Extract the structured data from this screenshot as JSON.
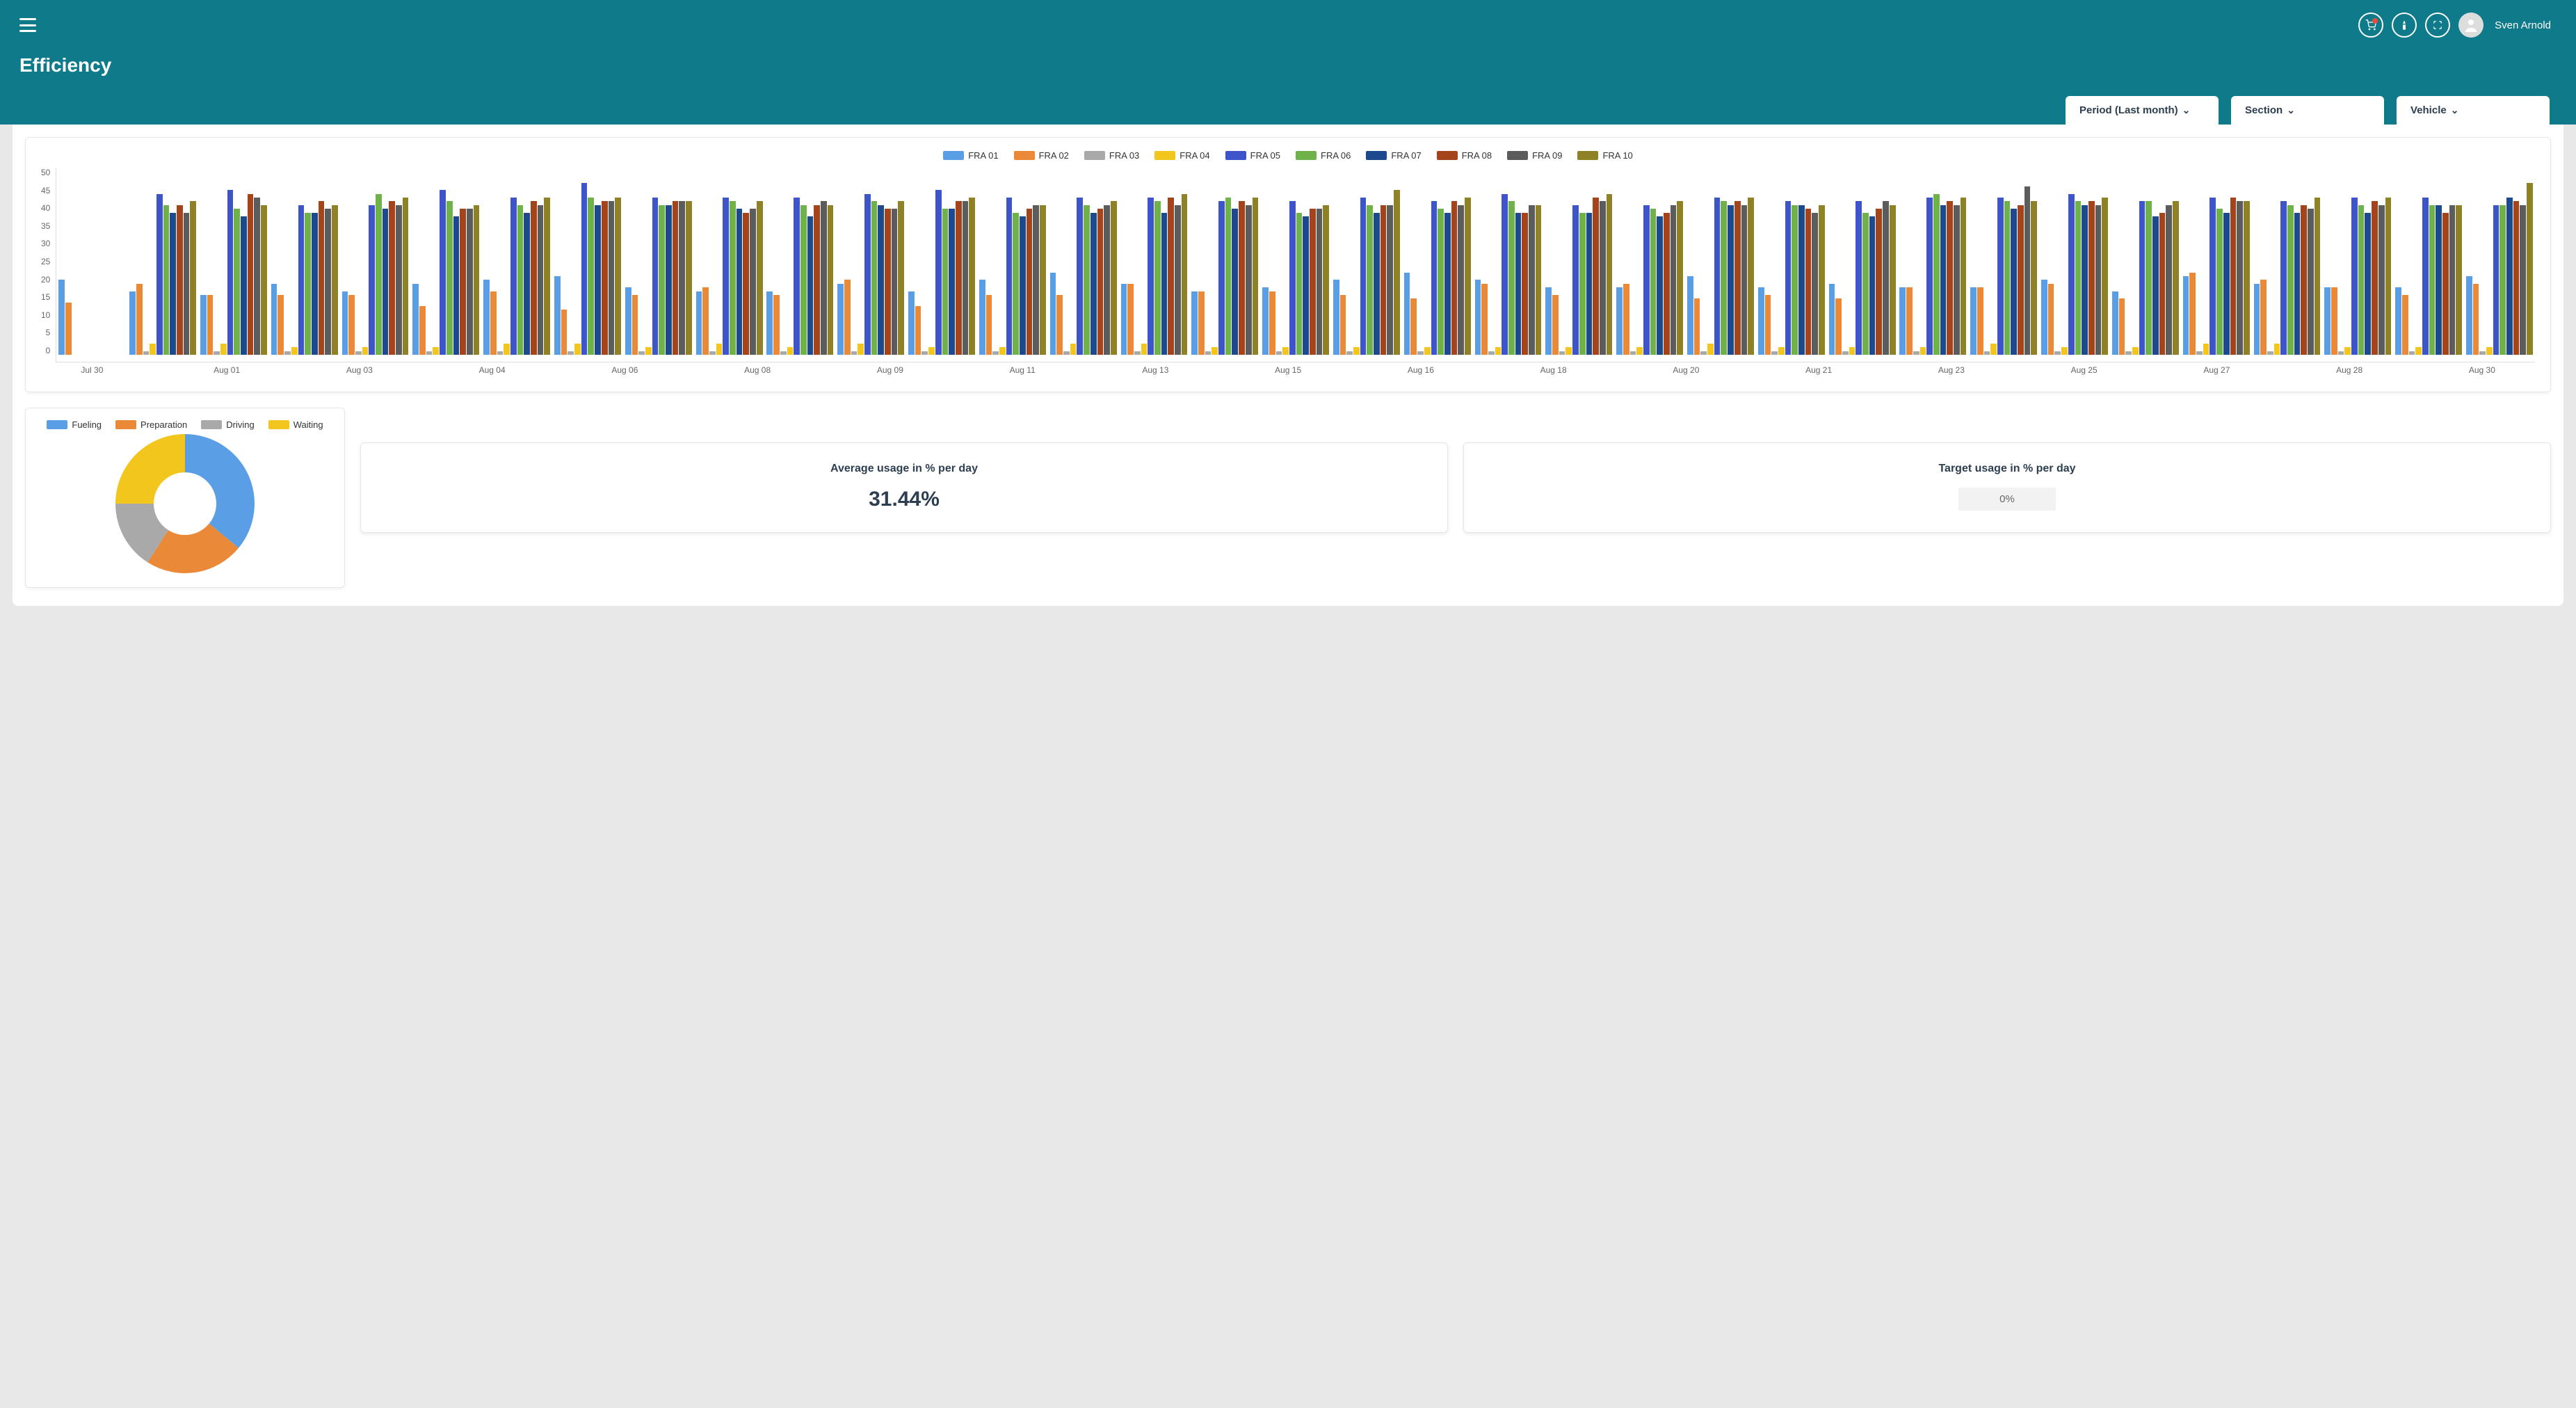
{
  "header": {
    "page_title": "Efficiency",
    "user_name": "Sven Arnold"
  },
  "filters": {
    "period_label": "Period (Last month)",
    "section_label": "Section",
    "vehicle_label": "Vehicle"
  },
  "colors": {
    "FRA01": "#5a9fe6",
    "FRA02": "#ea8938",
    "FRA03": "#a9a9a9",
    "FRA04": "#f3c61e",
    "FRA05": "#3d55c9",
    "FRA06": "#6fb24a",
    "FRA07": "#1d4a8e",
    "FRA08": "#a5441a",
    "FRA09": "#5c5c5c",
    "FRA10": "#8e8126"
  },
  "chart_data": {
    "bar": {
      "type": "bar",
      "ylim": [
        0,
        50
      ],
      "y_ticks": [
        50,
        45,
        40,
        35,
        30,
        25,
        20,
        15,
        10,
        5,
        0
      ],
      "series": [
        {
          "name": "FRA 01",
          "color": "FRA01"
        },
        {
          "name": "FRA 02",
          "color": "FRA02"
        },
        {
          "name": "FRA 03",
          "color": "FRA03"
        },
        {
          "name": "FRA 04",
          "color": "FRA04"
        },
        {
          "name": "FRA 05",
          "color": "FRA05"
        },
        {
          "name": "FRA 06",
          "color": "FRA06"
        },
        {
          "name": "FRA 07",
          "color": "FRA07"
        },
        {
          "name": "FRA 08",
          "color": "FRA08"
        },
        {
          "name": "FRA 09",
          "color": "FRA09"
        },
        {
          "name": "FRA 10",
          "color": "FRA10"
        }
      ],
      "categories": [
        "Jul 30",
        "",
        "Aug 01",
        "",
        "Aug 03",
        "",
        "Aug 04",
        "",
        "Aug 06",
        "",
        "Aug 08",
        "",
        "Aug 09",
        "",
        "Aug 11",
        "",
        "Aug 13",
        "",
        "Aug 15",
        "",
        "Aug 16",
        "",
        "Aug 18",
        "",
        "Aug 20",
        "",
        "Aug 21",
        "",
        "Aug 23",
        "",
        "Aug 25",
        "",
        "Aug 27",
        "",
        "Aug 28",
        "",
        "Aug 30"
      ],
      "rows": [
        [
          20,
          14,
          0,
          0,
          0,
          0,
          0,
          0,
          0,
          0
        ],
        [
          17,
          19,
          1,
          3,
          43,
          40,
          38,
          40,
          38,
          41
        ],
        [
          16,
          16,
          1,
          3,
          44,
          39,
          37,
          43,
          42,
          40
        ],
        [
          19,
          16,
          1,
          2,
          40,
          38,
          38,
          41,
          39,
          40
        ],
        [
          17,
          16,
          1,
          2,
          40,
          43,
          39,
          41,
          40,
          42
        ],
        [
          19,
          13,
          1,
          2,
          44,
          41,
          37,
          39,
          39,
          40
        ],
        [
          20,
          17,
          1,
          3,
          42,
          40,
          38,
          41,
          40,
          42
        ],
        [
          21,
          12,
          1,
          3,
          46,
          42,
          40,
          41,
          41,
          42
        ],
        [
          18,
          16,
          1,
          2,
          42,
          40,
          40,
          41,
          41,
          41
        ],
        [
          17,
          18,
          1,
          3,
          42,
          41,
          39,
          38,
          39,
          41
        ],
        [
          17,
          16,
          1,
          2,
          42,
          40,
          37,
          40,
          41,
          40
        ],
        [
          19,
          20,
          1,
          3,
          43,
          41,
          40,
          39,
          39,
          41
        ],
        [
          17,
          13,
          1,
          2,
          44,
          39,
          39,
          41,
          41,
          42
        ],
        [
          20,
          16,
          1,
          2,
          42,
          38,
          37,
          39,
          40,
          40
        ],
        [
          22,
          16,
          1,
          3,
          42,
          40,
          38,
          39,
          40,
          41
        ],
        [
          19,
          19,
          1,
          3,
          42,
          41,
          38,
          42,
          40,
          43
        ],
        [
          17,
          17,
          1,
          2,
          41,
          42,
          39,
          41,
          40,
          42
        ],
        [
          18,
          17,
          1,
          2,
          41,
          38,
          37,
          39,
          39,
          40
        ],
        [
          20,
          16,
          1,
          2,
          42,
          40,
          38,
          40,
          40,
          44
        ],
        [
          22,
          15,
          1,
          2,
          41,
          39,
          38,
          41,
          40,
          42
        ],
        [
          20,
          19,
          1,
          2,
          43,
          41,
          38,
          38,
          40,
          40
        ],
        [
          18,
          16,
          1,
          2,
          40,
          38,
          38,
          42,
          41,
          43
        ],
        [
          18,
          19,
          1,
          2,
          40,
          39,
          37,
          38,
          40,
          41
        ],
        [
          21,
          15,
          1,
          3,
          42,
          41,
          40,
          41,
          40,
          42
        ],
        [
          18,
          16,
          1,
          2,
          41,
          40,
          40,
          39,
          38,
          40
        ],
        [
          19,
          15,
          1,
          2,
          41,
          38,
          37,
          39,
          41,
          40
        ],
        [
          18,
          18,
          1,
          2,
          42,
          43,
          40,
          41,
          40,
          42
        ],
        [
          18,
          18,
          1,
          3,
          42,
          41,
          39,
          40,
          45,
          41
        ],
        [
          20,
          19,
          1,
          2,
          43,
          41,
          40,
          41,
          40,
          42
        ],
        [
          17,
          15,
          1,
          2,
          41,
          41,
          37,
          38,
          40,
          41
        ],
        [
          21,
          22,
          1,
          3,
          42,
          39,
          38,
          42,
          41,
          41
        ],
        [
          19,
          20,
          1,
          3,
          41,
          40,
          38,
          40,
          39,
          42
        ],
        [
          18,
          18,
          1,
          2,
          42,
          40,
          38,
          41,
          40,
          42
        ],
        [
          18,
          16,
          1,
          2,
          42,
          40,
          40,
          38,
          40,
          40
        ],
        [
          21,
          19,
          1,
          2,
          40,
          40,
          42,
          41,
          40,
          46
        ]
      ]
    },
    "pie": {
      "type": "pie",
      "series": [
        {
          "name": "Fueling",
          "value": 36,
          "color": "FRA01"
        },
        {
          "name": "Preparation",
          "value": 23,
          "color": "FRA02"
        },
        {
          "name": "Driving",
          "value": 16,
          "color": "FRA03"
        },
        {
          "name": "Waiting",
          "value": 25,
          "color": "FRA04"
        }
      ]
    }
  },
  "stats": {
    "avg_label": "Average usage in % per day",
    "avg_value": "31.44%",
    "target_label": "Target usage in % per day",
    "target_value": "0%"
  }
}
